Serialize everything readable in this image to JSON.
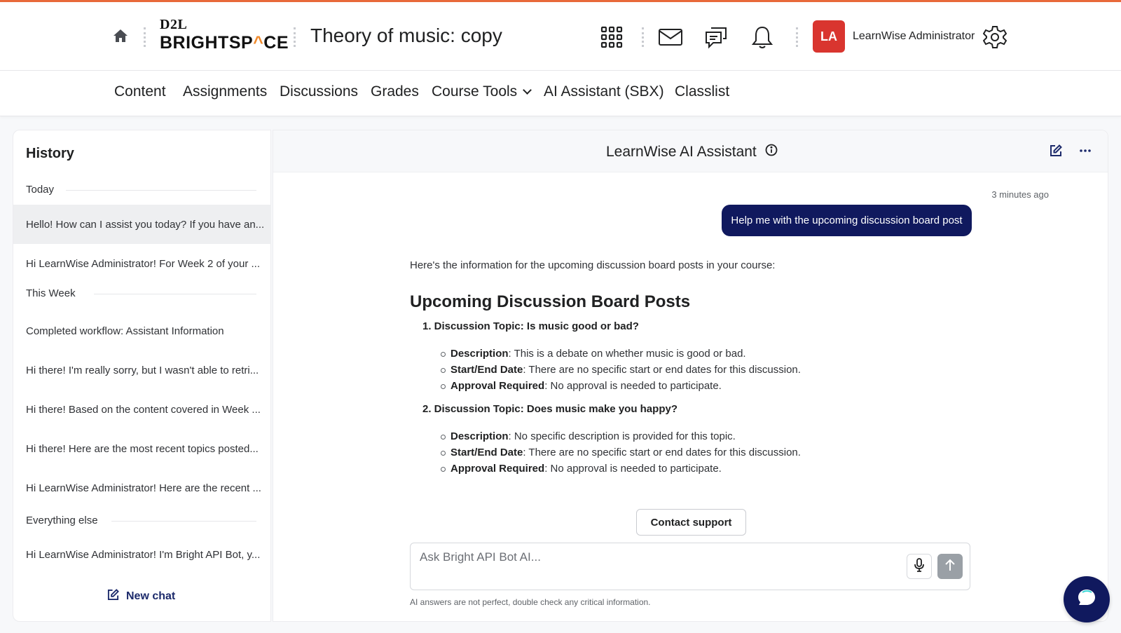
{
  "brand": {
    "logo_top": "D2L",
    "logo_main_a": "BRIGHTSP",
    "logo_main_caret": "^",
    "logo_main_b": "CE",
    "accent_color": "#e8693a"
  },
  "header": {
    "course_title": "Theory of music: copy",
    "user_initials": "LA",
    "user_name": "LearnWise Administrator",
    "avatar_color": "#d9352f",
    "icons": [
      "home-icon",
      "waffle-icon",
      "mail-icon",
      "chat-bubbles-icon",
      "bell-icon",
      "gear-icon"
    ]
  },
  "nav": {
    "items": [
      "Content",
      "Assignments",
      "Discussions",
      "Grades",
      "Course Tools",
      "AI Assistant (SBX)",
      "Classlist"
    ]
  },
  "history": {
    "title": "History",
    "groups": [
      "Today",
      "This Week",
      "Everything else"
    ],
    "items": [
      "Hello! How can I assist you today? If you have an...",
      "Hi LearnWise Administrator! For Week 2 of your ...",
      "Completed workflow: Assistant Information",
      "Hi there! I'm really sorry, but I wasn't able to retri...",
      "Hi there! Based on the content covered in Week ...",
      "Hi there! Here are the most recent topics posted...",
      "Hi LearnWise Administrator! Here are the recent ...",
      "Hi LearnWise Administrator! I'm Bright API Bot, y..."
    ],
    "new_chat": "New chat"
  },
  "chat": {
    "title": "LearnWise AI Assistant",
    "timestamp": "3 minutes ago",
    "user_message": "Help me with the upcoming discussion board post",
    "user_bubble_color": "#10195e",
    "answer_intro": "Here's the information for the upcoming discussion board posts in your course:",
    "answer_heading": "Upcoming Discussion Board Posts",
    "topics": [
      {
        "title": "1. Discussion Topic: Is music good or bad?",
        "details": [
          {
            "label": "Description",
            "text": ": This is a debate on whether music is good or bad."
          },
          {
            "label": "Start/End Date",
            "text": ": There are no specific start or end dates for this discussion."
          },
          {
            "label": "Approval Required",
            "text": ": No approval is needed to participate."
          }
        ]
      },
      {
        "title": "2. Discussion Topic: Does music make you happy?",
        "details": [
          {
            "label": "Description",
            "text": ": No specific description is provided for this topic."
          },
          {
            "label": "Start/End Date",
            "text": ": There are no specific start or end dates for this discussion."
          },
          {
            "label": "Approval Required",
            "text": ": No approval is needed to participate."
          }
        ]
      }
    ],
    "contact_support": "Contact support",
    "input_placeholder": "Ask Bright API Bot AI...",
    "disclaimer": "AI answers are not perfect, double check any critical information."
  }
}
